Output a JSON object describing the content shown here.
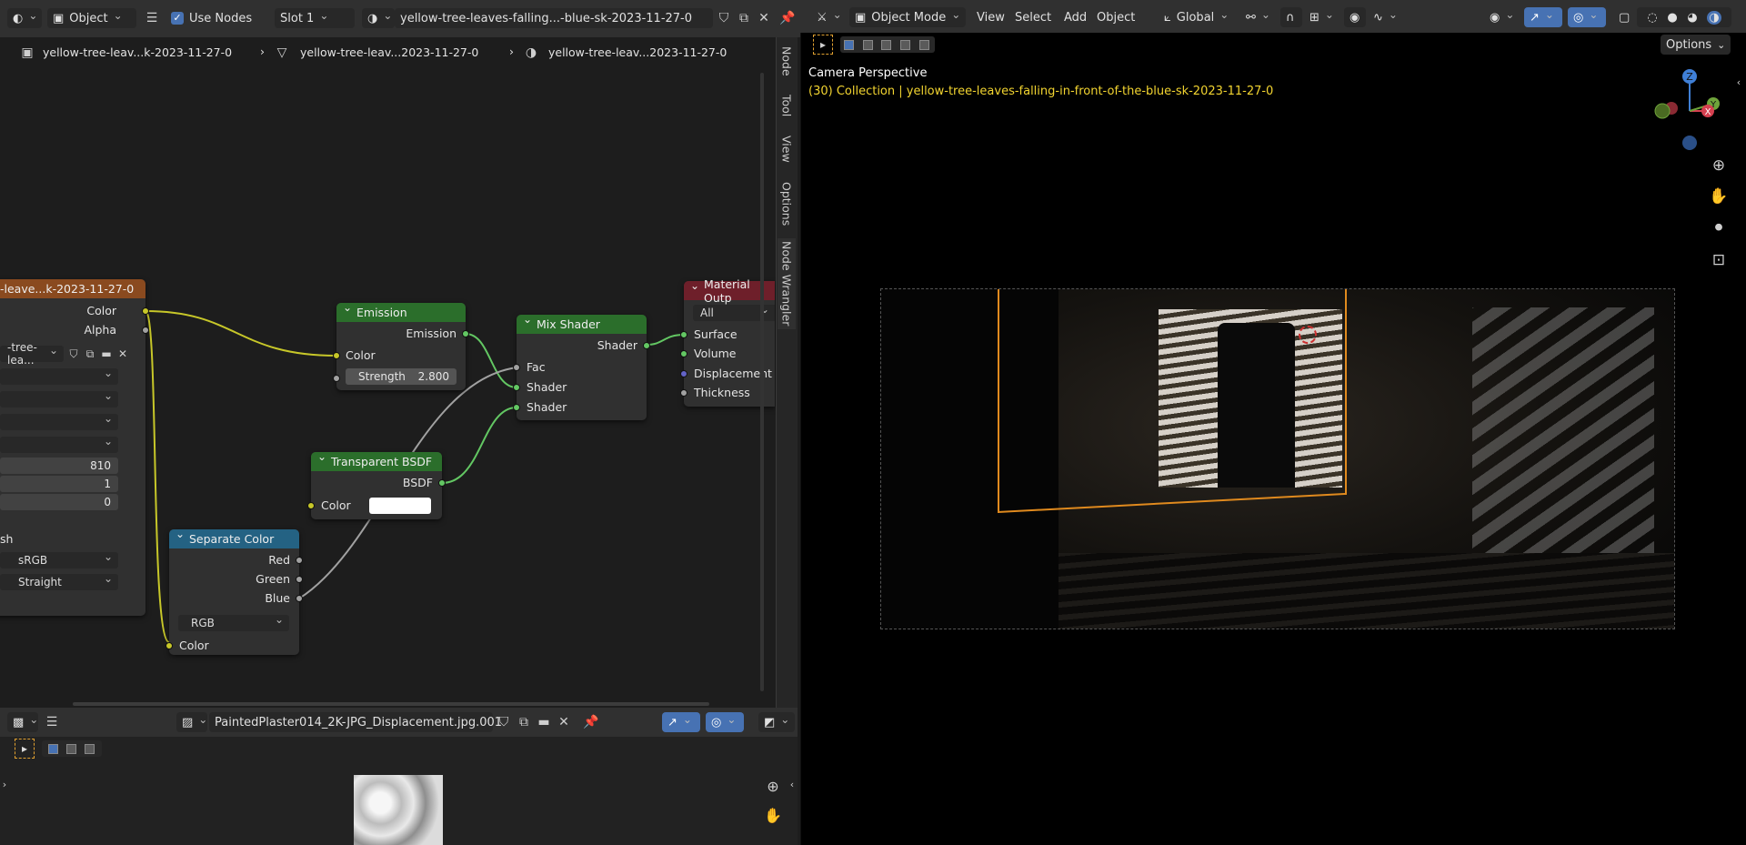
{
  "node_editor": {
    "header": {
      "object_type": "Object",
      "use_nodes_label": "Use Nodes",
      "slot": "Slot 1",
      "material_name": "yellow-tree-leaves-falling...-blue-sk-2023-11-27-0"
    },
    "breadcrumbs": [
      "yellow-tree-leav...k-2023-11-27-0",
      "yellow-tree-leav...2023-11-27-0",
      "yellow-tree-leav...2023-11-27-0"
    ],
    "side_tabs": [
      "Node",
      "Tool",
      "View",
      "Options",
      "Node Wrangler"
    ],
    "nodes": {
      "image_texture": {
        "title": "-leave...k-2023-11-27-0",
        "out_color": "Color",
        "out_alpha": "Alpha",
        "image_name": "-tree-lea...",
        "val1": "810",
        "val2": "1",
        "val3": "0",
        "label_fragment": "sh",
        "colorspace": "sRGB",
        "alpha_mode": "Straight"
      },
      "emission": {
        "title": "Emission",
        "out": "Emission",
        "in_color": "Color",
        "strength_label": "Strength",
        "strength_value": "2.800"
      },
      "mix_shader": {
        "title": "Mix Shader",
        "out": "Shader",
        "in_fac": "Fac",
        "in_shader1": "Shader",
        "in_shader2": "Shader"
      },
      "transparent": {
        "title": "Transparent BSDF",
        "out": "BSDF",
        "in_color": "Color"
      },
      "separate_color": {
        "title": "Separate Color",
        "out_red": "Red",
        "out_green": "Green",
        "out_blue": "Blue",
        "mode": "RGB",
        "in_color": "Color"
      },
      "material_output": {
        "title": "Material Outp",
        "target": "All",
        "in_surface": "Surface",
        "in_volume": "Volume",
        "in_displacement": "Displacement",
        "in_thickness": "Thickness"
      }
    }
  },
  "image_editor": {
    "image_name": "PaintedPlaster014_2K-JPG_Displacement.jpg.001"
  },
  "viewport": {
    "mode": "Object Mode",
    "menu": [
      "View",
      "Select",
      "Add",
      "Object"
    ],
    "orientation": "Global",
    "options_label": "Options",
    "overlay_title": "Camera Perspective",
    "overlay_subtitle": "(30) Collection | yellow-tree-leaves-falling-in-front-of-the-blue-sk-2023-11-27-0",
    "gizmo": {
      "z": "Z",
      "x": "X",
      "y": "Y"
    }
  },
  "colors": {
    "accent_blue": "#4772b3",
    "selection_orange": "#e08a1e",
    "overlay_yellow": "#f2d430",
    "emission_header": "#2b6e2b",
    "separate_header": "#246283",
    "output_header": "#6e1f2a",
    "texture_header": "#8a4a1f"
  }
}
